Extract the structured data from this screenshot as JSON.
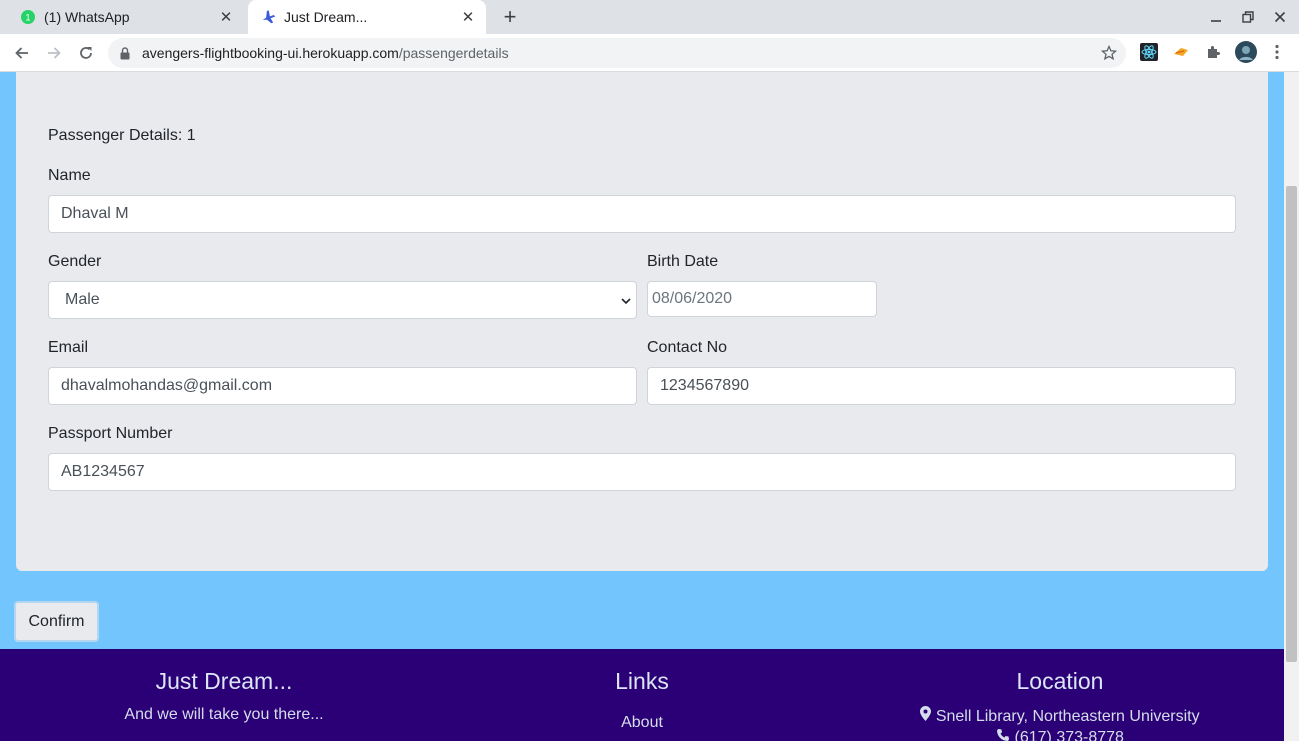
{
  "browser": {
    "tabs": [
      {
        "title": "(1) WhatsApp",
        "badge": "1",
        "active": false
      },
      {
        "title": "Just Dream...",
        "active": true
      }
    ],
    "url_host": "avengers-flightbooking-ui.herokuapp.com",
    "url_path": "/passengerdetails"
  },
  "form": {
    "heading": "Passenger Details: 1",
    "name_label": "Name",
    "name_value": "Dhaval M",
    "gender_label": "Gender",
    "gender_value": "Male",
    "birth_label": "Birth Date",
    "birth_value": "08/06/2020",
    "email_label": "Email",
    "email_value": "dhavalmohandas@gmail.com",
    "contact_label": "Contact No",
    "contact_value": "1234567890",
    "passport_label": "Passport Number",
    "passport_value": "AB1234567"
  },
  "confirm_label": "Confirm",
  "footer": {
    "brand_title": "Just Dream...",
    "brand_tagline": "And we will take you there...",
    "links_title": "Links",
    "link_about": "About",
    "location_title": "Location",
    "location_address": "Snell Library, Northeastern University",
    "location_phone": "(617) 373-8778"
  },
  "colors": {
    "page_bg": "#72c6fd",
    "card_bg": "#e9eaee",
    "footer_bg": "#2b0076",
    "whatsapp_green": "#25d366",
    "flight_icon_blue": "#3b5bdb"
  }
}
